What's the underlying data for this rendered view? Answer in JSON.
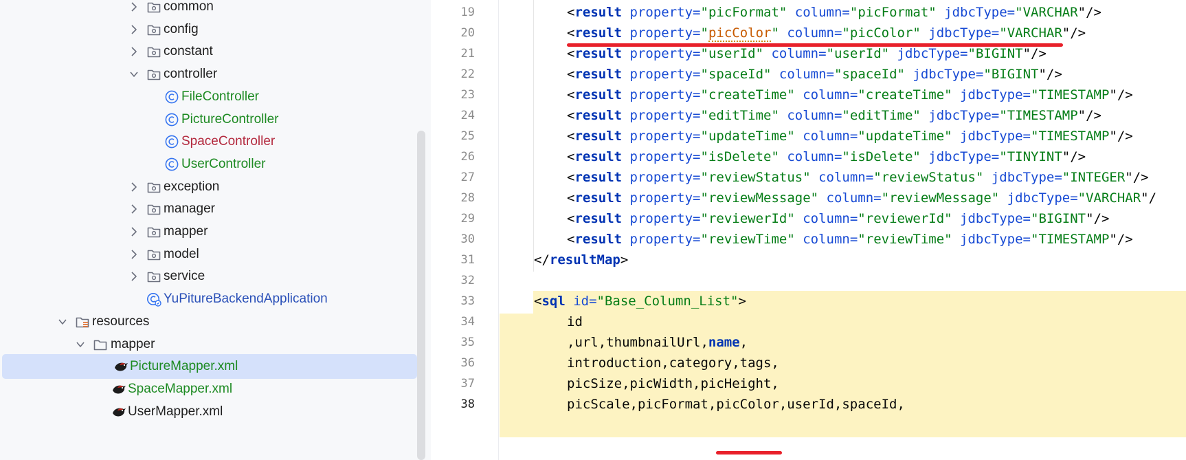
{
  "tree": {
    "items": [
      {
        "label": "common",
        "kind": "folder",
        "state": "collapsed",
        "color": "default"
      },
      {
        "label": "config",
        "kind": "folder",
        "state": "collapsed",
        "color": "default"
      },
      {
        "label": "constant",
        "kind": "folder",
        "state": "collapsed",
        "color": "default"
      },
      {
        "label": "controller",
        "kind": "folder",
        "state": "expanded",
        "color": "default"
      },
      {
        "label": "FileController",
        "kind": "class",
        "color": "green"
      },
      {
        "label": "PictureController",
        "kind": "class",
        "color": "green"
      },
      {
        "label": "SpaceController",
        "kind": "class",
        "color": "red"
      },
      {
        "label": "UserController",
        "kind": "class",
        "color": "green"
      },
      {
        "label": "exception",
        "kind": "folder",
        "state": "collapsed",
        "color": "default"
      },
      {
        "label": "manager",
        "kind": "folder",
        "state": "collapsed",
        "color": "default"
      },
      {
        "label": "mapper",
        "kind": "folder",
        "state": "collapsed",
        "color": "default"
      },
      {
        "label": "model",
        "kind": "folder",
        "state": "collapsed",
        "color": "default"
      },
      {
        "label": "service",
        "kind": "folder",
        "state": "collapsed",
        "color": "default"
      },
      {
        "label": "YuPitureBackendApplication",
        "kind": "app-class",
        "color": "blue"
      },
      {
        "label": "resources",
        "kind": "resources-folder",
        "state": "expanded",
        "color": "default"
      },
      {
        "label": "mapper",
        "kind": "folder",
        "state": "expanded",
        "color": "default"
      },
      {
        "label": "PictureMapper.xml",
        "kind": "mybatis-xml",
        "color": "green",
        "selected": true
      },
      {
        "label": "SpaceMapper.xml",
        "kind": "mybatis-xml",
        "color": "green"
      },
      {
        "label": "UserMapper.xml",
        "kind": "mybatis-xml",
        "color": "default"
      }
    ]
  },
  "gutter": {
    "line_numbers": [
      "19",
      "20",
      "21",
      "22",
      "23",
      "24",
      "25",
      "26",
      "27",
      "28",
      "29",
      "30",
      "31",
      "32",
      "33",
      "34",
      "35",
      "36",
      "37",
      "38"
    ],
    "current_line": "38"
  },
  "editor": {
    "result_lines": [
      {
        "prop": "picFormat",
        "col": "picFormat",
        "type": "VARCHAR",
        "tail": "\"/>"
      },
      {
        "prop": "picColor",
        "col": "picColor",
        "type": "VARCHAR",
        "tail": "\"/>"
      },
      {
        "prop": "userId",
        "col": "userId",
        "type": "BIGINT",
        "tail": "\"/>"
      },
      {
        "prop": "spaceId",
        "col": "spaceId",
        "type": "BIGINT",
        "tail": "\"/>"
      },
      {
        "prop": "createTime",
        "col": "createTime",
        "type": "TIMESTAMP",
        "tail": "\"/>"
      },
      {
        "prop": "editTime",
        "col": "editTime",
        "type": "TIMESTAMP",
        "tail": "\"/>"
      },
      {
        "prop": "updateTime",
        "col": "updateTime",
        "type": "TIMESTAMP",
        "tail": "\"/>"
      },
      {
        "prop": "isDelete",
        "col": "isDelete",
        "type": "TINYINT",
        "tail": "\"/>"
      },
      {
        "prop": "reviewStatus",
        "col": "reviewStatus",
        "type": "INTEGER",
        "tail": "\"/>"
      },
      {
        "prop": "reviewMessage",
        "col": "reviewMessage",
        "type": "VARCHAR",
        "tail": "\"/"
      },
      {
        "prop": "reviewerId",
        "col": "reviewerId",
        "type": "BIGINT",
        "tail": "\"/>"
      },
      {
        "prop": "reviewTime",
        "col": "reviewTime",
        "type": "TIMESTAMP",
        "tail": "\"/>"
      }
    ],
    "tokens": {
      "lt": "<",
      "result": "result",
      "property_eq": " property=",
      "column_eq": " column=",
      "jdbcType_eq": " jdbcType=",
      "q": "\"",
      "close_tag_open": "</",
      "resultMap": "resultMap",
      "gt": ">",
      "sql": "sql",
      "id_eq": " id=",
      "sql_id": "\"Base_Column_List\""
    },
    "sql_lines": {
      "l34": "id",
      "l35_a": ",url,thumbnailUrl,",
      "l35_kw": "name",
      "l35_b": ",",
      "l36": "introduction,category,tags,",
      "l37": "picSize,picWidth,picHeight,",
      "l38_a": "picScale,picFormat,",
      "l38_b": "picColor",
      "l38_c": ",userId,spaceId,"
    },
    "colors": {
      "tag": "#0033b3",
      "attribute": "#174ad4",
      "string": "#067d17",
      "highlight": "#fdf3c2",
      "annotation_red": "#e8202a"
    }
  }
}
